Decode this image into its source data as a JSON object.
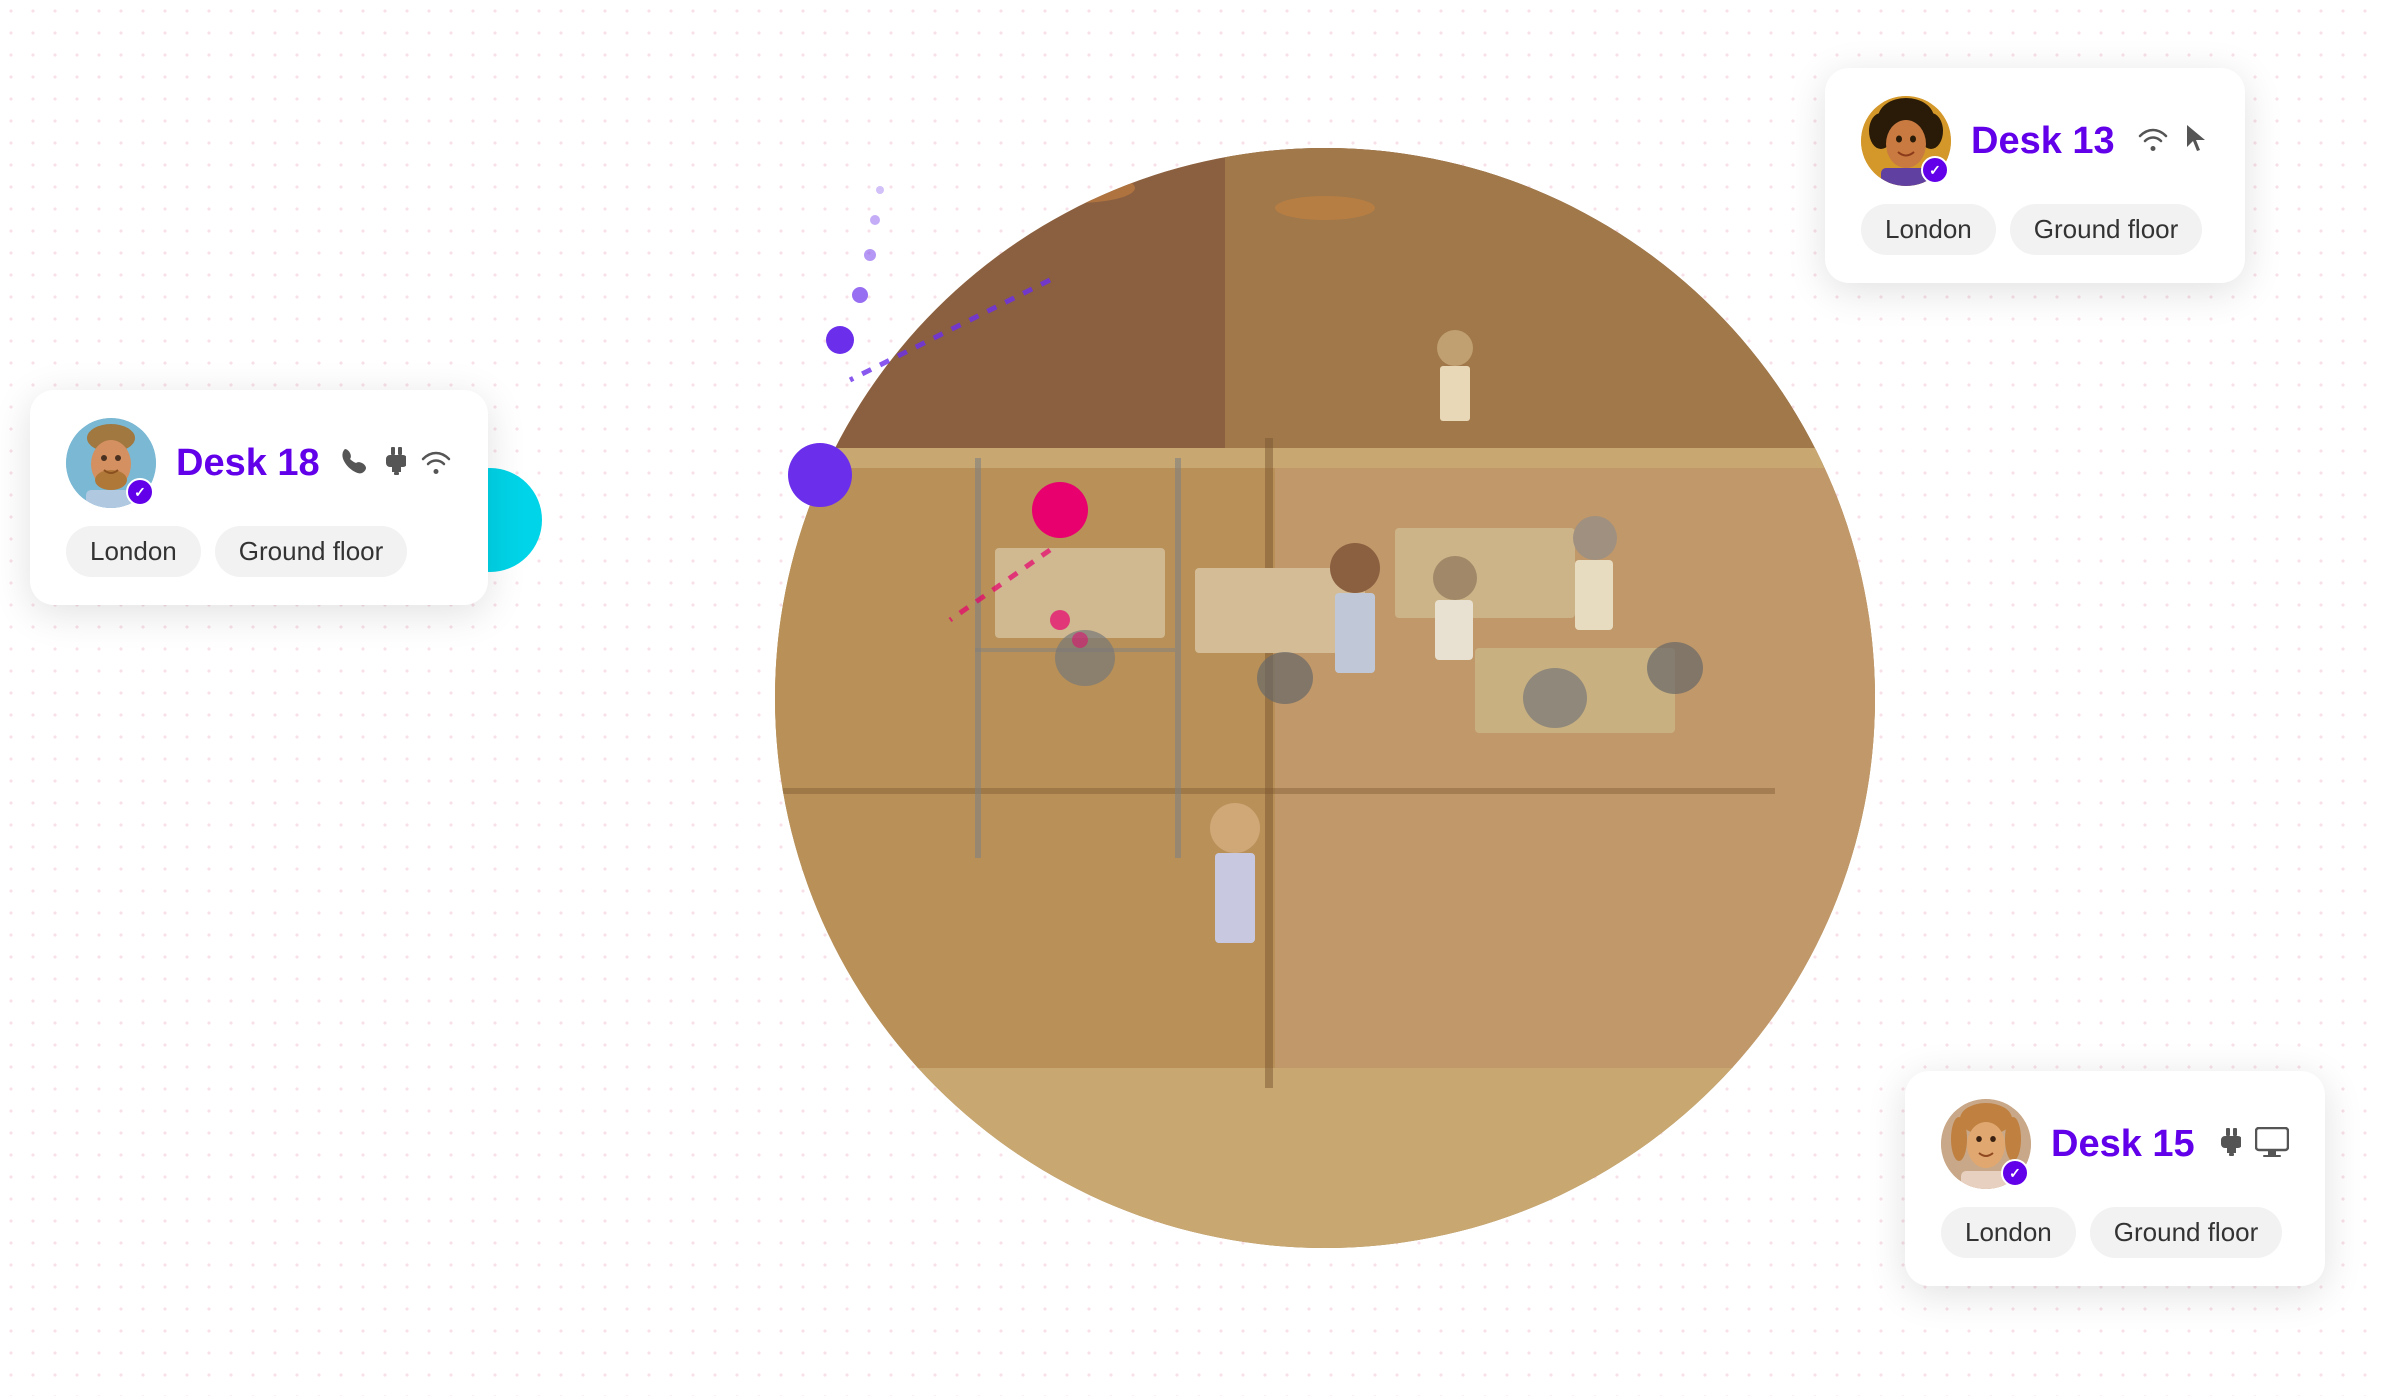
{
  "background": {
    "dot_color": "#f0c0d0"
  },
  "cards": {
    "desk13": {
      "title": "Desk 13",
      "location": "London",
      "floor": "Ground floor",
      "icons": [
        "wifi",
        "cursor"
      ],
      "avatar_bg": "#d4982a",
      "position": "top-right"
    },
    "desk18": {
      "title": "Desk 18",
      "location": "London",
      "floor": "Ground floor",
      "icons": [
        "phone",
        "plug",
        "wifi"
      ],
      "avatar_bg": "#7ab8d4",
      "position": "left"
    },
    "desk15": {
      "title": "Desk 15",
      "location": "London",
      "floor": "Ground floor",
      "icons": [
        "plug",
        "monitor"
      ],
      "avatar_bg": "#c8a888",
      "position": "bottom-right"
    }
  },
  "tags": {
    "london": "London",
    "ground_floor": "Ground floor"
  },
  "indicator_dots": {
    "purple": "#6b2fec",
    "cyan": "#00d4e8",
    "pink": "#e8006e"
  }
}
